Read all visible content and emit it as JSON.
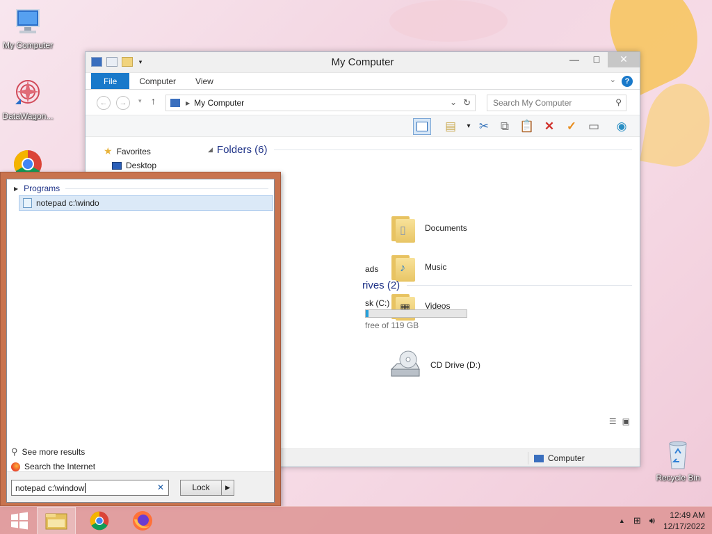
{
  "desktop": {
    "icons": [
      {
        "label": "My Computer"
      },
      {
        "label": "DataWagon..."
      },
      {
        "label": "Recycle Bin"
      }
    ]
  },
  "explorer": {
    "title": "My Computer",
    "ribbon_tabs": [
      "File",
      "Computer",
      "View"
    ],
    "address_path": "My Computer",
    "search_placeholder": "Search My Computer",
    "nav": {
      "favorites": "Favorites",
      "desktop": "Desktop"
    },
    "folders_header": "Folders (6)",
    "folders": [
      {
        "name": "Documents",
        "icon": "document-icon"
      },
      {
        "name": "Music",
        "icon": "music-note-icon"
      },
      {
        "name": "Videos",
        "icon": "film-icon"
      }
    ],
    "partial_folder_label": "ads",
    "drives_header": "rives (2)",
    "local_disk": {
      "label": "sk (C:)",
      "free_text": "free of 119 GB",
      "used_fraction": 0.03
    },
    "cd_drive": {
      "label": "CD Drive (D:)"
    },
    "status_location": "Computer"
  },
  "search_panel": {
    "section_header": "Programs",
    "result": "notepad c:\\windo",
    "see_more": "See more results",
    "search_internet": "Search the Internet",
    "input_value": "notepad c:\\window",
    "lock_label": "Lock"
  },
  "taskbar": {
    "time": "12:49 AM",
    "date": "12/17/2022"
  },
  "colors": {
    "accent": "#1979ca",
    "taskbar": "#de9696",
    "panel_frame": "#c8734e"
  }
}
